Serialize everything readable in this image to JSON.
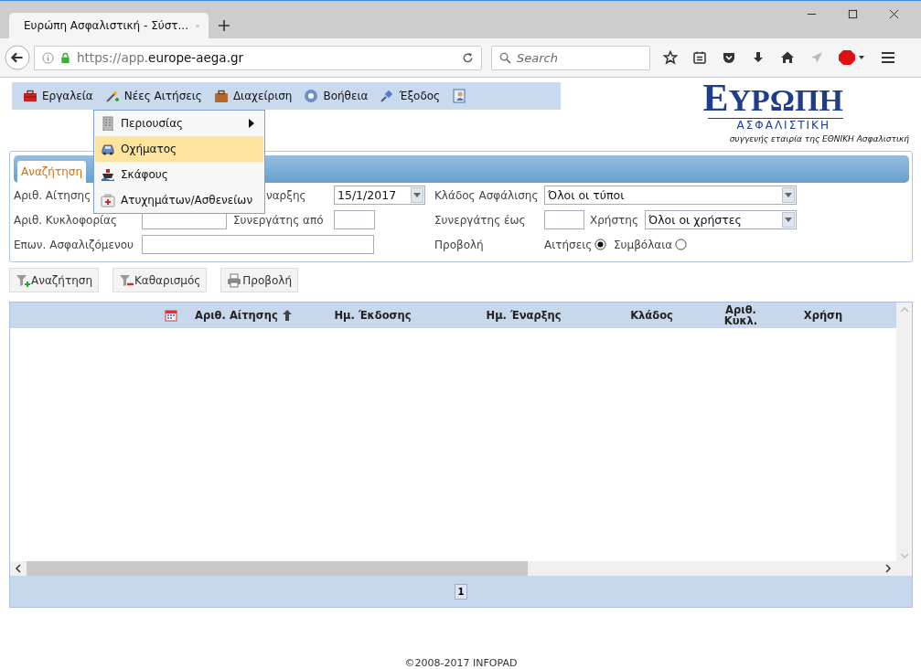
{
  "browser": {
    "tab_title": "Ευρώπη Ασφαλιστική - Σύστ...",
    "url_scheme": "https://app.",
    "url_domain": "europe-aega.gr",
    "search_placeholder": "Search"
  },
  "menu": {
    "items": [
      {
        "kind": "text",
        "label": "Εργαλεία"
      },
      {
        "kind": "text",
        "label": "Νέες Αιτήσεις"
      },
      {
        "kind": "text",
        "label": "Διαχείριση"
      },
      {
        "kind": "text",
        "label": "Βοήθεια"
      },
      {
        "kind": "text",
        "label": "Έξοδος"
      },
      {
        "kind": "icon"
      }
    ]
  },
  "dropdown": {
    "items": [
      {
        "label": "Περιουσίας",
        "selected": false,
        "submenu": true
      },
      {
        "label": "Οχήματος",
        "selected": true,
        "submenu": false
      },
      {
        "label": "Σκάφους",
        "selected": false,
        "submenu": false
      },
      {
        "label": "Ατυχημάτων/Ασθενείων",
        "selected": false,
        "submenu": false
      }
    ]
  },
  "logo": {
    "title": "ΕΥΡΩΠΗ",
    "subtitle": "ΑΣΦΑΛΙΣΤΙΚΗ",
    "tagline": "συγγενής εταιρία της ΕΘΝΙΚΗ Ασφαλιστική"
  },
  "search_panel": {
    "tabs": [
      {
        "label": "Αναζήτηση",
        "selected": true
      }
    ],
    "fields": [
      {
        "kind": "label",
        "text": "Αριθ. Αίτησης"
      },
      {
        "kind": "label",
        "text": "ναρξης"
      },
      {
        "kind": "date",
        "value": "15/1/2017"
      },
      {
        "kind": "label",
        "text": "Κλάδος Ασφάλισης"
      },
      {
        "kind": "select",
        "value": "Όλοι οι τύποι"
      },
      {
        "kind": "label",
        "text": "Αριθ. Κυκλοφορίας"
      },
      {
        "kind": "input"
      },
      {
        "kind": "label",
        "text": "Συνεργάτης από"
      },
      {
        "kind": "input"
      },
      {
        "kind": "label",
        "text": "Συνεργάτης έως"
      },
      {
        "kind": "input"
      },
      {
        "kind": "label",
        "text": "Χρήστης"
      },
      {
        "kind": "select",
        "value": "Όλοι οι χρήστες"
      },
      {
        "kind": "label",
        "text": "Επων. Ασφαλιζόμενου"
      },
      {
        "kind": "input"
      },
      {
        "kind": "label",
        "text": "Προβολή"
      },
      {
        "kind": "radio",
        "text": "Αιτήσεις",
        "selected": true
      },
      {
        "kind": "radio",
        "text": "Συμβόλαια",
        "selected": false
      }
    ]
  },
  "buttons": [
    "Αναζήτηση",
    "Καθαρισμός",
    "Προβολή"
  ],
  "table": {
    "columns": [
      {
        "label": "Αριθ. Αίτησης",
        "sorted": true
      },
      {
        "label": "Ημ. Έκδοσης",
        "sorted": false
      },
      {
        "label": "Ημ. Έναρξης",
        "sorted": false
      },
      {
        "label": "Κλάδος",
        "sorted": false
      },
      {
        "label": "Αριθ. Κυκλ.",
        "sorted": false
      },
      {
        "label": "Χρήση",
        "sorted": false
      }
    ],
    "pages": [
      {
        "label": "1",
        "selected": true
      }
    ]
  },
  "footer": "©2008-2017 INFOPAD"
}
